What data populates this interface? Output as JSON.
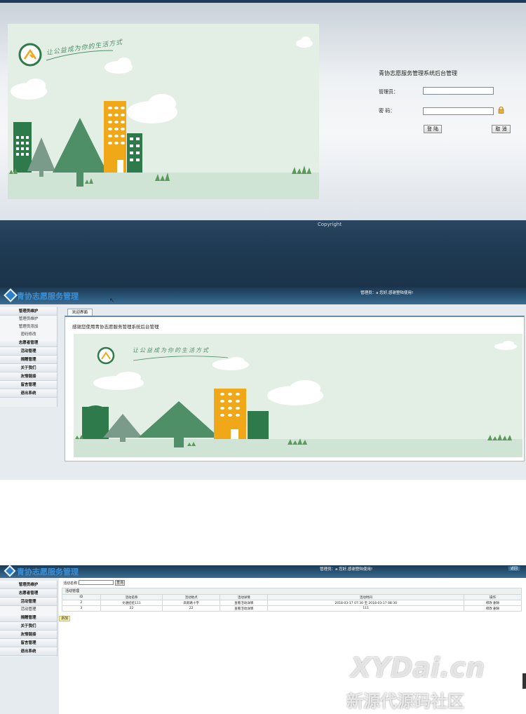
{
  "login": {
    "slogan": "让公益成为你的生活方式",
    "title": "青协志愿服务管理系统后台管理",
    "admin_label": "管理员：",
    "password_label": "密 码：",
    "admin_value": "",
    "password_value": "",
    "login_button": "登 陆",
    "cancel_button": "取 消",
    "copyright": "Copyright"
  },
  "admin": {
    "brand": "青协志愿服务管理",
    "welcome": "管理员：a 您好,感谢登陆使用!",
    "sidebar": [
      {
        "label": "管理员维护",
        "subs": [
          "管理员维护",
          "管理员添加",
          "密码修改"
        ]
      },
      {
        "label": "志愿者管理"
      },
      {
        "label": "活动管理"
      },
      {
        "label": "捐赠管理"
      },
      {
        "label": "关于我们"
      },
      {
        "label": "友情链接"
      },
      {
        "label": "留言管理"
      },
      {
        "label": "退出系统"
      }
    ],
    "tab_label": "欢迎界面",
    "welcome_text": "感谢您使用青协志愿服务管理系统后台管理"
  },
  "activity": {
    "brand": "青协志愿服务管理",
    "welcome": "管理员：a 您好,感谢登陆使用!",
    "back_button": "返回",
    "sidebar": [
      {
        "label": "管理员维护"
      },
      {
        "label": "志愿者管理"
      },
      {
        "label": "活动管理",
        "subs": [
          "活动管理"
        ]
      },
      {
        "label": "捐赠管理"
      },
      {
        "label": "关于我们"
      },
      {
        "label": "友情链接"
      },
      {
        "label": "留言管理"
      },
      {
        "label": "退出系统"
      }
    ],
    "search_label": "活动名称：",
    "search_value": "",
    "search_button": "查询",
    "panel_title": "活动管理",
    "columns": [
      "ID",
      "活动名称",
      "活动地点",
      "活动详情",
      "活动时间",
      "操作"
    ],
    "rows": [
      [
        "2",
        "文通娃娃111",
        "高新路十字",
        "查看活动详情",
        "2018-03-17 07:30 至 2018-03-17 08:30",
        "修改 删除"
      ],
      [
        "3",
        "22",
        "22",
        "查看活动详情",
        "111",
        "修改 删除"
      ]
    ],
    "add_button": "添加"
  },
  "watermark": {
    "line1": "XYDai.cn",
    "line2": "新源代源码社区"
  },
  "colors": {
    "header_dark": "#1d3a55",
    "brand_blue": "#3a8fd6",
    "tree_green": "#4e8f68",
    "building_yellow": "#f0a818",
    "building_green": "#2e7a4a"
  }
}
